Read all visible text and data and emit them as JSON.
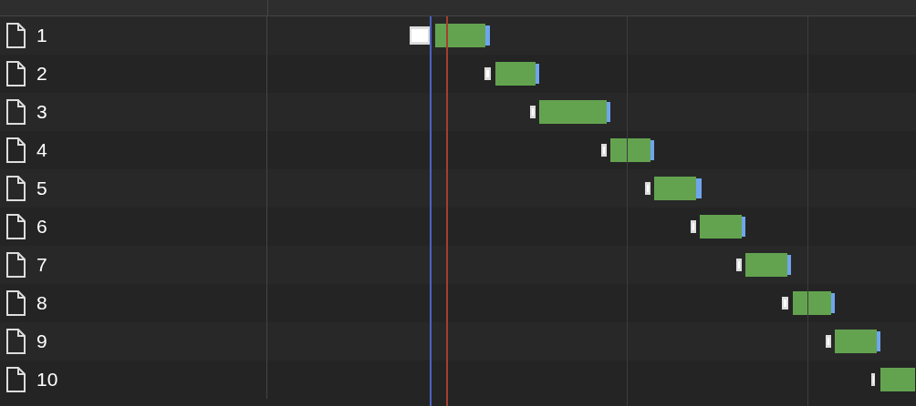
{
  "requests": [
    {
      "name": "1"
    },
    {
      "name": "2"
    },
    {
      "name": "3"
    },
    {
      "name": "4"
    },
    {
      "name": "5"
    },
    {
      "name": "6"
    },
    {
      "name": "7"
    },
    {
      "name": "8"
    },
    {
      "name": "9"
    },
    {
      "name": "10"
    }
  ]
}
